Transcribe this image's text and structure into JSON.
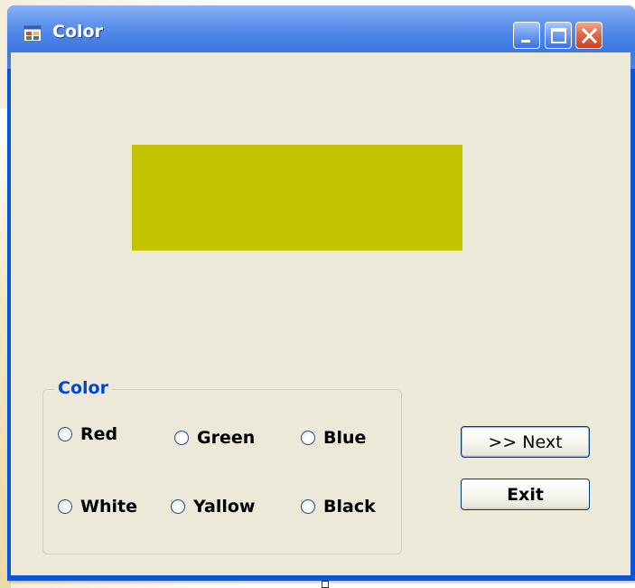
{
  "window": {
    "title": "Color",
    "app_icon": "app-form-icon",
    "controls": {
      "minimize_icon": "minimize-icon",
      "maximize_icon": "maximize-icon",
      "close_icon": "close-icon"
    }
  },
  "color_display": {
    "current_color": "#c3c300"
  },
  "color_group": {
    "title": "Color",
    "options": [
      {
        "label": "Red"
      },
      {
        "label": "Green"
      },
      {
        "label": "Blue"
      },
      {
        "label": "White"
      },
      {
        "label": "Yallow"
      },
      {
        "label": "Black"
      }
    ]
  },
  "buttons": {
    "next_label": ">> Next",
    "exit_label": "Exit"
  },
  "colors": {
    "titlebar": "#3e78e2",
    "client_background": "#ece9d8",
    "group_title": "#0046d5"
  }
}
